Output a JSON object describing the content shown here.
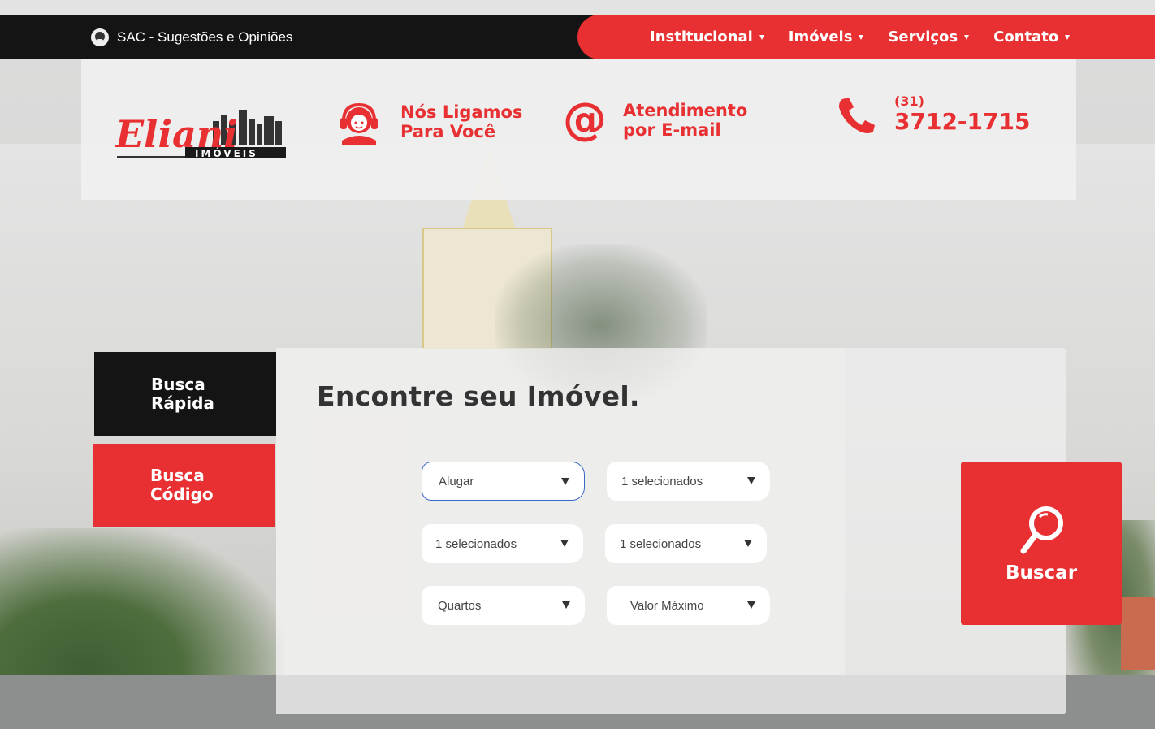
{
  "topbar": {
    "sac_label": "SAC - Sugestões e Opiniões",
    "nav": [
      {
        "label": "Institucional"
      },
      {
        "label": "Imóveis"
      },
      {
        "label": "Serviços"
      },
      {
        "label": "Contato"
      }
    ]
  },
  "header": {
    "logo_text": "Eliani",
    "logo_subtext": "IMÓVEIS",
    "contacts": {
      "call": {
        "line1": "Nós Ligamos",
        "line2": "Para Você",
        "icon": "headset-icon"
      },
      "email": {
        "line1": "Atendimento",
        "line2": "por E-mail",
        "icon": "at-sign-icon"
      },
      "phone": {
        "area": "(31)",
        "number": "3712-1715",
        "icon": "phone-icon"
      }
    }
  },
  "search": {
    "tabs": [
      {
        "line1": "Busca",
        "line2": "Rápida"
      },
      {
        "line1": "Busca",
        "line2": "Código"
      }
    ],
    "title": "Encontre seu Imóvel.",
    "fields": {
      "purpose": "Alugar",
      "type": "1 selecionados",
      "city": "1 selecionados",
      "neighborhood": "1 selecionados",
      "rooms": "Quartos",
      "max_value": "Valor Máximo"
    },
    "submit_label": "Buscar"
  },
  "colors": {
    "brand_red": "#e83033",
    "dark": "#141414"
  }
}
